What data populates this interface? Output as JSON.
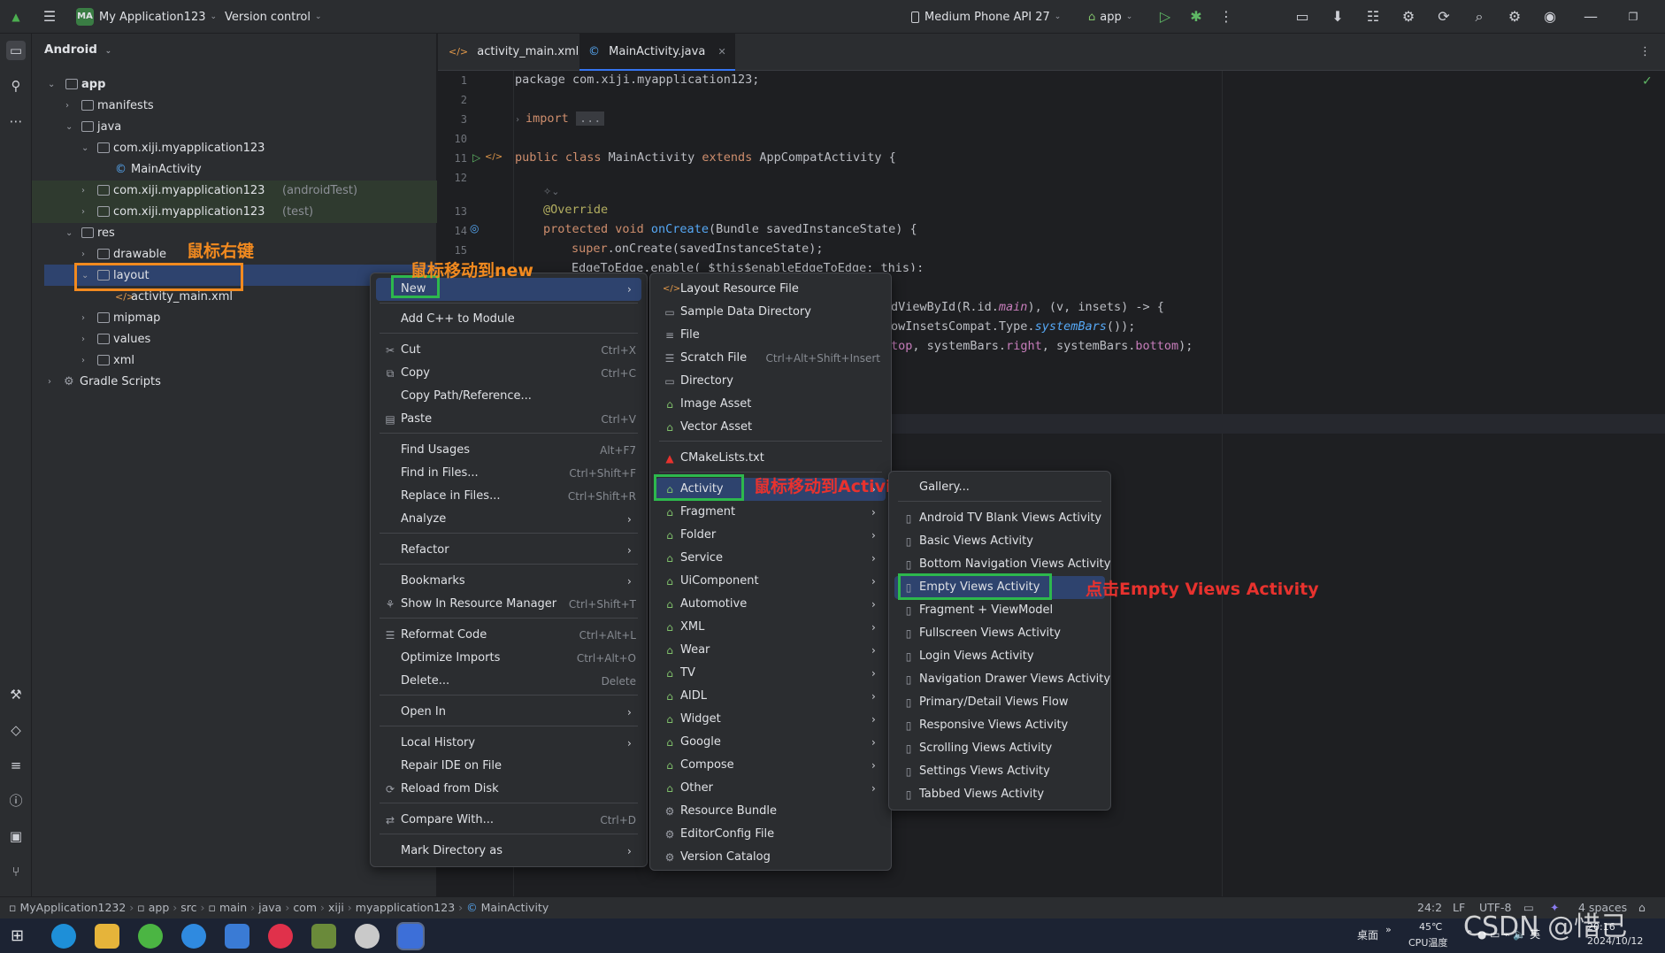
{
  "titlebar": {
    "project_badge": "MA",
    "project_name": "My Application123",
    "vcs": "Version control",
    "device": "Medium Phone API 27",
    "run_config": "app"
  },
  "sidebar": {
    "title": "Android"
  },
  "tree": [
    {
      "label": "app",
      "bold": true
    },
    {
      "label": "manifests"
    },
    {
      "label": "java"
    },
    {
      "label": "com.xiji.myapplication123"
    },
    {
      "label": "MainActivity"
    },
    {
      "label": "com.xiji.myapplication123",
      "suffix": "(androidTest)"
    },
    {
      "label": "com.xiji.myapplication123",
      "suffix": "(test)"
    },
    {
      "label": "res"
    },
    {
      "label": "drawable"
    },
    {
      "label": "layout"
    },
    {
      "label": "activity_main.xml"
    },
    {
      "label": "mipmap"
    },
    {
      "label": "values"
    },
    {
      "label": "xml"
    },
    {
      "label": "Gradle Scripts"
    }
  ],
  "editor_tabs": [
    {
      "label": "activity_main.xml"
    },
    {
      "label": "MainActivity.java"
    }
  ],
  "code": {
    "line_numbers": [
      "1",
      "2",
      "3",
      "10",
      "11",
      "12",
      "13",
      "14",
      "15"
    ],
    "l1": "package com.xiji.myapplication123;",
    "l3_kw": "import",
    "l3_fold": "...",
    "l11_a": "public class ",
    "l11_b": "MainActivity ",
    "l11_c": "extends ",
    "l11_d": "AppCompatActivity {",
    "l13": "@Override",
    "l14_a": "protected void ",
    "l14_b": "onCreate",
    "l14_c": "(Bundle savedInstanceState) {",
    "l15_a": "super",
    "l15_b": ".onCreate(savedInstanceState);",
    "l16": "EdgeToEdge.enable( $this$enableEdgeToEdge: this);",
    "r1_a": "dViewById(R.id.",
    "r1_b": "main",
    "r1_c": "), (v, insets) -> {",
    "r2_a": "owInsetsCompat.Type.",
    "r2_b": "systemBars",
    "r2_c": "());",
    "r3_a": "top",
    "r3_b": ", systemBars.",
    "r3_c": "right",
    "r3_d": ", systemBars.",
    "r3_e": "bottom",
    "r3_f": ");"
  },
  "context_menu": [
    {
      "label": "New",
      "arrow": true
    },
    {
      "label": "Add C++ to Module"
    },
    {
      "label": "Cut",
      "shortcut": "Ctrl+X"
    },
    {
      "label": "Copy",
      "shortcut": "Ctrl+C"
    },
    {
      "label": "Copy Path/Reference..."
    },
    {
      "label": "Paste",
      "shortcut": "Ctrl+V"
    },
    {
      "label": "Find Usages",
      "shortcut": "Alt+F7"
    },
    {
      "label": "Find in Files...",
      "shortcut": "Ctrl+Shift+F"
    },
    {
      "label": "Replace in Files...",
      "shortcut": "Ctrl+Shift+R"
    },
    {
      "label": "Analyze",
      "arrow": true
    },
    {
      "label": "Refactor",
      "arrow": true
    },
    {
      "label": "Bookmarks",
      "arrow": true
    },
    {
      "label": "Show In Resource Manager",
      "shortcut": "Ctrl+Shift+T"
    },
    {
      "label": "Reformat Code",
      "shortcut": "Ctrl+Alt+L"
    },
    {
      "label": "Optimize Imports",
      "shortcut": "Ctrl+Alt+O"
    },
    {
      "label": "Delete...",
      "shortcut": "Delete"
    },
    {
      "label": "Open In",
      "arrow": true
    },
    {
      "label": "Local History",
      "arrow": true
    },
    {
      "label": "Repair IDE on File"
    },
    {
      "label": "Reload from Disk"
    },
    {
      "label": "Compare With...",
      "shortcut": "Ctrl+D"
    },
    {
      "label": "Mark Directory as",
      "arrow": true
    }
  ],
  "new_menu": [
    {
      "label": "Layout Resource File"
    },
    {
      "label": "Sample Data Directory"
    },
    {
      "label": "File"
    },
    {
      "label": "Scratch File",
      "shortcut": "Ctrl+Alt+Shift+Insert"
    },
    {
      "label": "Directory"
    },
    {
      "label": "Image Asset"
    },
    {
      "label": "Vector Asset"
    },
    {
      "label": "CMakeLists.txt"
    },
    {
      "label": "Activity",
      "arrow": true
    },
    {
      "label": "Fragment",
      "arrow": true
    },
    {
      "label": "Folder",
      "arrow": true
    },
    {
      "label": "Service",
      "arrow": true
    },
    {
      "label": "UiComponent",
      "arrow": true
    },
    {
      "label": "Automotive",
      "arrow": true
    },
    {
      "label": "XML",
      "arrow": true
    },
    {
      "label": "Wear",
      "arrow": true
    },
    {
      "label": "TV",
      "arrow": true
    },
    {
      "label": "AIDL",
      "arrow": true
    },
    {
      "label": "Widget",
      "arrow": true
    },
    {
      "label": "Google",
      "arrow": true
    },
    {
      "label": "Compose",
      "arrow": true
    },
    {
      "label": "Other",
      "arrow": true
    },
    {
      "label": "Resource Bundle"
    },
    {
      "label": "EditorConfig File"
    },
    {
      "label": "Version Catalog"
    }
  ],
  "activity_menu": [
    {
      "label": "Gallery..."
    },
    {
      "label": "Android TV Blank Views Activity"
    },
    {
      "label": "Basic Views Activity"
    },
    {
      "label": "Bottom Navigation Views Activity"
    },
    {
      "label": "Empty Views Activity"
    },
    {
      "label": "Fragment + ViewModel"
    },
    {
      "label": "Fullscreen Views Activity"
    },
    {
      "label": "Login Views Activity"
    },
    {
      "label": "Navigation Drawer Views Activity"
    },
    {
      "label": "Primary/Detail Views Flow"
    },
    {
      "label": "Responsive Views Activity"
    },
    {
      "label": "Scrolling Views Activity"
    },
    {
      "label": "Settings Views Activity"
    },
    {
      "label": "Tabbed Views Activity"
    }
  ],
  "annotations": {
    "right_click": "鼠标右键",
    "move_new": "鼠标移动到new",
    "move_activity": "鼠标移动到Activity",
    "click_empty": "点击Empty Views Activity",
    "orange": "#f28a1f",
    "green": "#2db84d",
    "red": "#e8322e"
  },
  "breadcrumb": [
    "MyApplication1232",
    "app",
    "src",
    "main",
    "java",
    "com",
    "xiji",
    "myapplication123",
    "MainActivity"
  ],
  "status": {
    "position": "24:2",
    "line_sep": "LF",
    "encoding": "UTF-8",
    "indent": "4 spaces"
  },
  "taskbar": {
    "desktop": "桌面",
    "temp": "45℃",
    "temp_label": "CPU温度",
    "time": "20:16",
    "date": "2024/10/12",
    "watermark": "CSDN @惜己"
  }
}
